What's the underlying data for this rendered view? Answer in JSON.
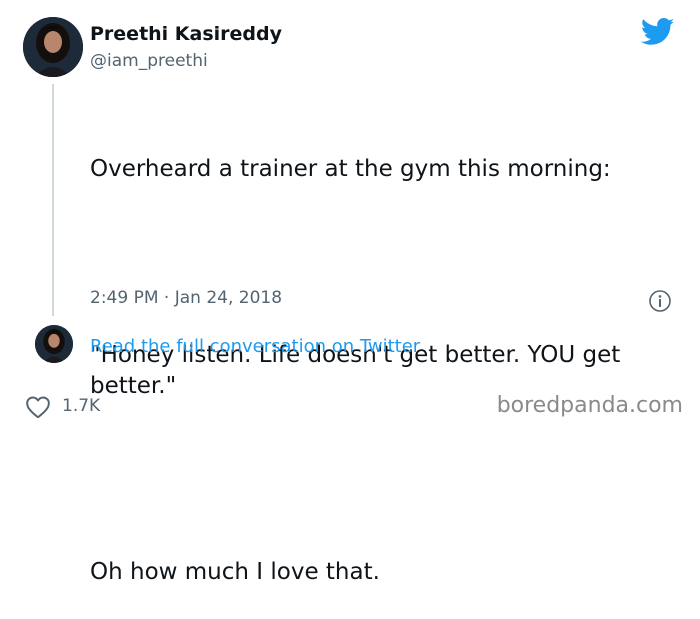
{
  "author": {
    "display_name": "Preethi Kasireddy",
    "handle": "@iam_preethi"
  },
  "icons": {
    "brand": "twitter-bird-icon",
    "info": "info-icon",
    "like": "heart-icon"
  },
  "tweet": {
    "line1": "Overheard a trainer at the gym this morning:",
    "line2": "\"Honey listen. Life doesn't get better. YOU get better.\"",
    "line3": "Oh how much I love that.",
    "timestamp": "2:49 PM · Jan 24, 2018"
  },
  "thread": {
    "read_full_label": "Read the full conversation on Twitter"
  },
  "engagement": {
    "likes": "1.7K"
  },
  "watermark": "boredpanda.com",
  "colors": {
    "twitter_blue": "#1d9bf0",
    "text_primary": "#0f1419",
    "text_secondary": "#536471",
    "thread_line": "#cfd9de"
  }
}
